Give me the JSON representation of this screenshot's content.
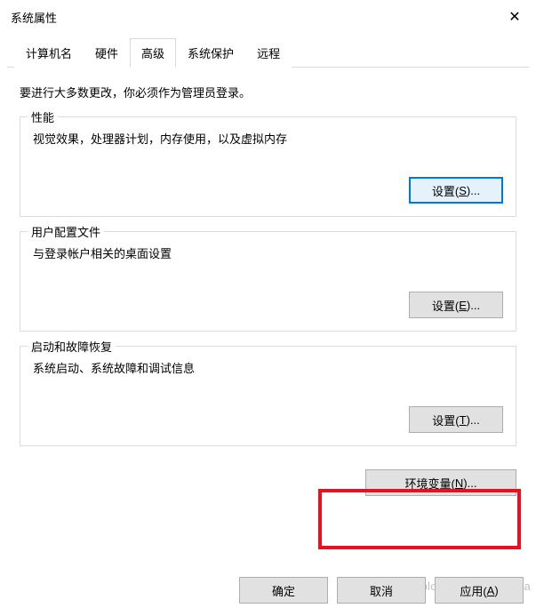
{
  "title": "系统属性",
  "tabs": {
    "computer_name": "计算机名",
    "hardware": "硬件",
    "advanced": "高级",
    "system_protection": "系统保护",
    "remote": "远程"
  },
  "instruction": "要进行大多数更改，你必须作为管理员登录。",
  "performance": {
    "title": "性能",
    "desc": "视觉效果，处理器计划，内存使用，以及虚拟内存",
    "button_prefix": "设置(",
    "button_key": "S",
    "button_suffix": ")..."
  },
  "user_profiles": {
    "title": "用户配置文件",
    "desc": "与登录帐户相关的桌面设置",
    "button_prefix": "设置(",
    "button_key": "E",
    "button_suffix": ")..."
  },
  "startup": {
    "title": "启动和故障恢复",
    "desc": "系统启动、系统故障和调试信息",
    "button_prefix": "设置(",
    "button_key": "T",
    "button_suffix": ")..."
  },
  "env_button": {
    "prefix": "环境变量(",
    "key": "N",
    "suffix": ")..."
  },
  "footer": {
    "ok": "确定",
    "cancel": "取消",
    "apply_prefix": "应用(",
    "apply_key": "A",
    "apply_suffix": ")"
  },
  "watermark": "https://blog.csdn.net/Amiga"
}
